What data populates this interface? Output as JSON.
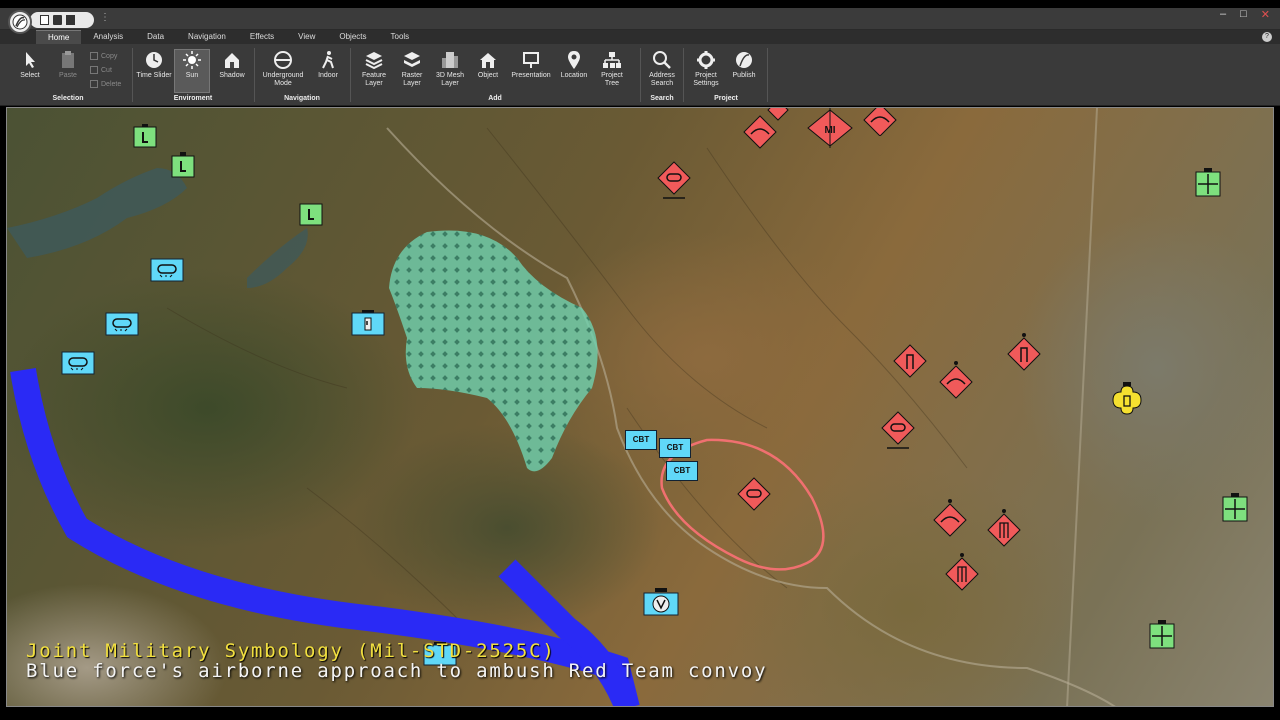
{
  "titlebar": {
    "window_buttons": [
      "–",
      "□",
      "✕"
    ]
  },
  "menu": {
    "tabs": [
      "Home",
      "Analysis",
      "Data",
      "Navigation",
      "Effects",
      "View",
      "Objects",
      "Tools"
    ],
    "active": "Home"
  },
  "ribbon": {
    "groups": {
      "selection": "Selection",
      "environment": "Enviroment",
      "navigation": "Navigation",
      "add": "Add",
      "search": "Search",
      "project": "Project"
    },
    "buttons": {
      "select": "Select",
      "paste": "Paste",
      "copy": "Copy",
      "cut": "Cut",
      "delete": "Delete",
      "time_slider": "Time Slider",
      "sun": "Sun",
      "shadow": "Shadow",
      "underground_mode": "Underground Mode",
      "indoor": "Indoor",
      "feature_layer": "Feature Layer",
      "raster_layer": "Raster Layer",
      "mesh_layer": "3D Mesh Layer",
      "object": "Object",
      "presentation": "Presentation",
      "location": "Location",
      "project_tree": "Project Tree",
      "address_search": "Address Search",
      "project_settings": "Project Settings",
      "publish": "Publish"
    }
  },
  "map": {
    "unit_labels": {
      "cbt": "CBT",
      "mi": "MI"
    },
    "colors": {
      "friendly": "#60d8f8",
      "hostile": "#f05a5a",
      "neutral": "#7ee07e",
      "unknown": "#f5e030",
      "airborne_route": "#2a2af5",
      "zone_fill": "#6fd2b0"
    }
  },
  "caption": {
    "line1": "Joint Military Symbology (Mil-STD-2525C)",
    "line2": "Blue force's airborne approach to ambush Red Team convoy"
  }
}
